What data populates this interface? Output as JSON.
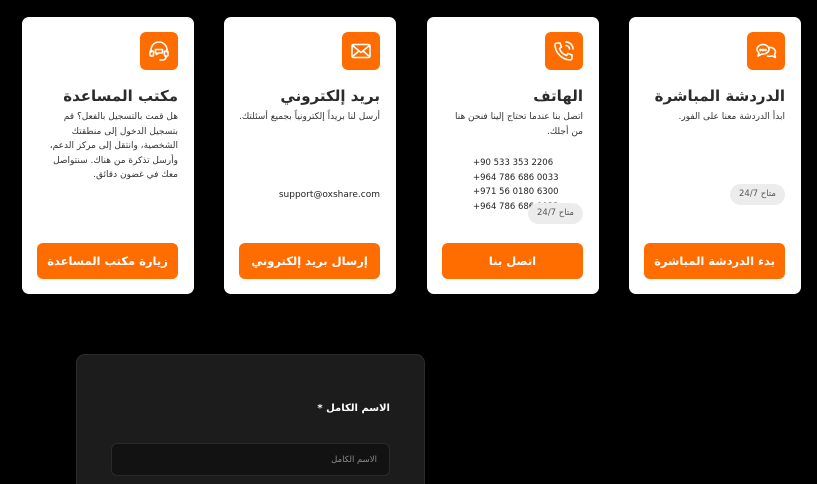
{
  "theme": {
    "accent": "#ff6d00",
    "background": "#000000",
    "card": "#ffffff",
    "panel": "#1c1c1c"
  },
  "cards": [
    {
      "icon": "chat-bubbles-icon",
      "title": "الدردشة المباشرة",
      "desc": "ابدأ الدردشة معنا على الفور.",
      "badge": "متاح 24/7",
      "button": "بدء الدردشة المباشرة"
    },
    {
      "icon": "phone-icon",
      "title": "الهاتف",
      "desc": "اتصل بنا عندما تحتاج إلينا فنحن هنا من أجلك.",
      "phones": [
        "+90 533 353 2206",
        "+964 786 686 0033",
        "+971 56 0180 6300",
        "+964 786 686 0033"
      ],
      "badge": "متاح 24/7",
      "button": "اتصل بنا"
    },
    {
      "icon": "envelope-icon",
      "title": "بريد إلكتروني",
      "desc": "أرسل لنا بريداً إلكترونياً بجميع أسئلتك.",
      "email": "support@oxshare.com",
      "button": "إرسال بريد إلكتروني"
    },
    {
      "icon": "headset-icon",
      "title": "مكتب المساعدة",
      "desc": "هل قمت بالتسجيل بالفعل؟ قم بتسجيل الدخول إلى منطقتك الشخصية، وانتقل إلى مركز الدعم، وأرسل تذكرة من هناك. سنتواصل معك في غضون دقائق.",
      "button": "زيارة مكتب المساعدة"
    }
  ],
  "form": {
    "name_label": "الاسم الكامل *",
    "name_placeholder": "الاسم الكامل"
  }
}
